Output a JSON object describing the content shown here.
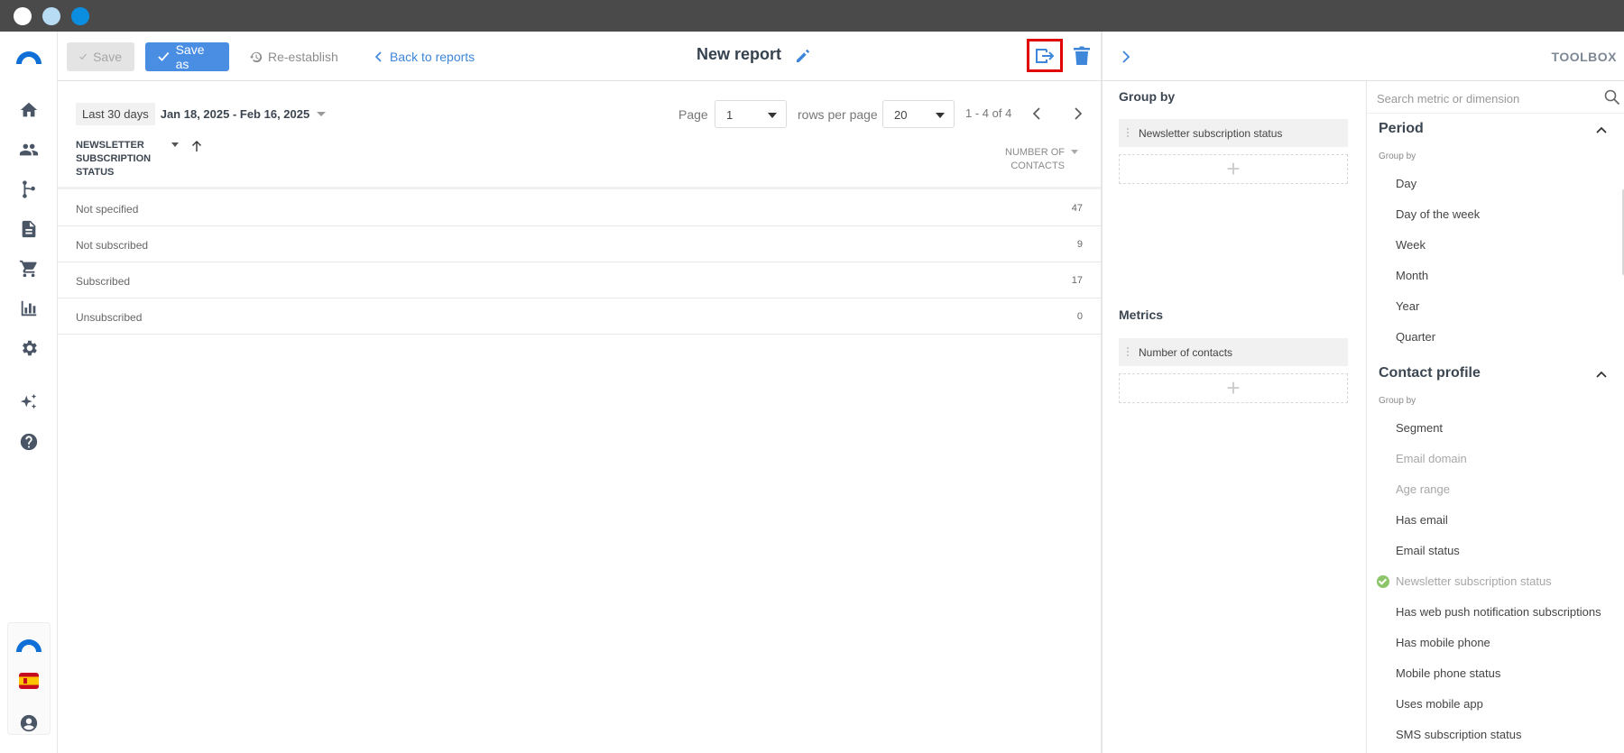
{
  "toolbar": {
    "save_label": "Save",
    "save_as_label": "Save as",
    "reestablish_label": "Re-establish",
    "back_label": "Back to reports",
    "report_title": "New report"
  },
  "filters": {
    "period_chip": "Last 30 days",
    "date_range": "Jan 18, 2025 - Feb 16, 2025"
  },
  "pagination": {
    "page_label": "Page",
    "page_value": "1",
    "rows_label": "rows per page",
    "rows_value": "20",
    "range_text": "1 - 4 of 4"
  },
  "table": {
    "col_left_lines": [
      "NEWSLETTER",
      "SUBSCRIPTION",
      "STATUS"
    ],
    "col_right_lines": [
      "NUMBER OF",
      "CONTACTS"
    ],
    "rows": [
      {
        "label": "Not specified",
        "value": "47"
      },
      {
        "label": "Not subscribed",
        "value": "9"
      },
      {
        "label": "Subscribed",
        "value": "17"
      },
      {
        "label": "Unsubscribed",
        "value": "0"
      }
    ]
  },
  "panel": {
    "toolbox_title": "TOOLBOX",
    "group_by_title": "Group by",
    "group_by_item": "Newsletter subscription status",
    "metrics_title": "Metrics",
    "metrics_item": "Number of contacts",
    "dropzone_symbol": "+"
  },
  "toolbox": {
    "search_placeholder": "Search metric or dimension",
    "period": {
      "title": "Period",
      "sub": "Group by",
      "items": [
        "Day",
        "Day of the week",
        "Week",
        "Month",
        "Year",
        "Quarter"
      ]
    },
    "contact_profile": {
      "title": "Contact profile",
      "sub": "Group by",
      "items": [
        "Segment",
        "Email domain",
        "Age range",
        "Has email",
        "Email status",
        "Newsletter subscription status",
        "Has web push notification subscriptions",
        "Has mobile phone",
        "Mobile phone status",
        "Uses mobile app",
        "SMS subscription status"
      ]
    }
  },
  "colors": {
    "accent": "#4a8ee3",
    "link": "#3d86d9",
    "highlight_border": "#e00000",
    "check_green": "#8cc56a"
  }
}
